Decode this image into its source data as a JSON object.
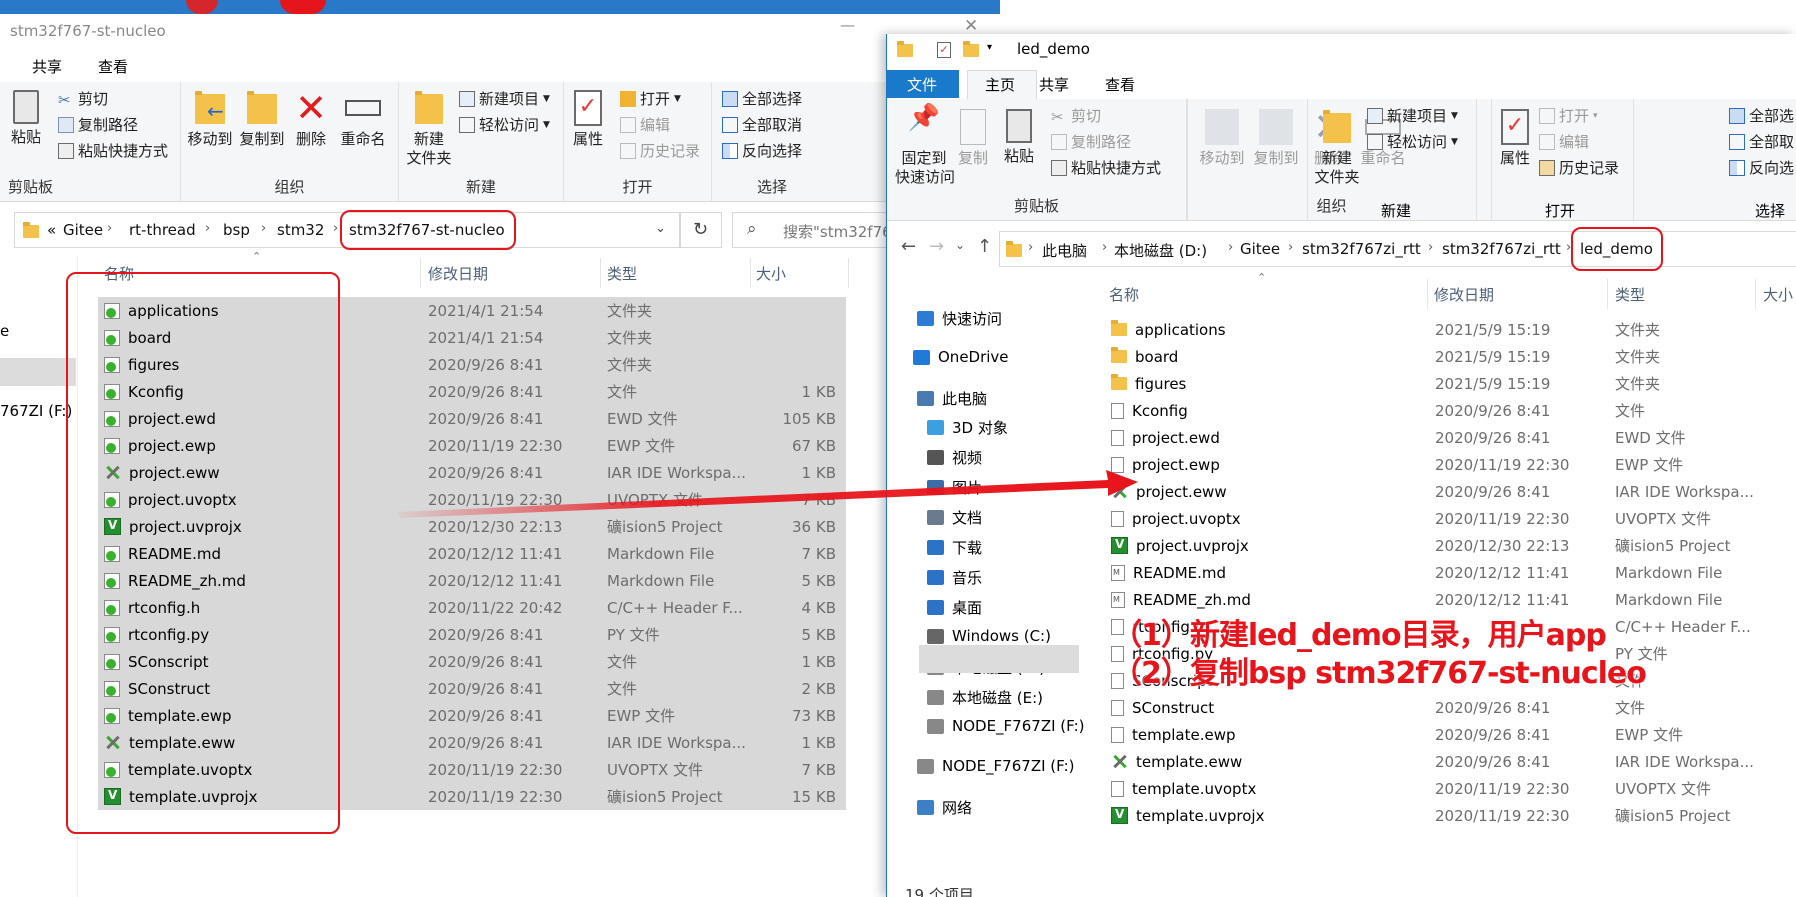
{
  "win1": {
    "title": "stm32f767-st-nucleo",
    "tabs": [
      "共享",
      "查看"
    ],
    "clipboard": {
      "paste": "粘贴",
      "cut": "剪切",
      "copy_path": "复制路径",
      "paste_shortcut": "粘贴快捷方式",
      "group": "剪贴板"
    },
    "organize": {
      "move_to": "移动到",
      "copy_to": "复制到",
      "delete": "删除",
      "rename": "重命名",
      "group": "组织"
    },
    "new": {
      "new_folder": "新建\n文件夹",
      "new_item": "新建项目",
      "easy_access": "轻松访问",
      "group": "新建"
    },
    "open": {
      "properties": "属性",
      "open": "打开",
      "edit": "编辑",
      "history": "历史记录",
      "group": "打开"
    },
    "select": {
      "select_all": "全部选择",
      "select_none": "全部取消",
      "invert": "反向选择",
      "group": "选择"
    },
    "address": {
      "crumbs": [
        "Gitee",
        "rt-thread",
        "bsp",
        "stm32",
        "stm32f767-st-nucleo"
      ],
      "prefix": "«"
    },
    "search_placeholder": "搜索\"stm32f76",
    "columns": {
      "name": "名称",
      "date": "修改日期",
      "type": "类型",
      "size": "大小"
    },
    "nav_fragments": [
      "e",
      "767ZI (F:)"
    ],
    "files": [
      {
        "name": "applications",
        "date": "2021/4/1 21:54",
        "type": "文件夹",
        "size": ""
      },
      {
        "name": "board",
        "date": "2021/4/1 21:54",
        "type": "文件夹",
        "size": ""
      },
      {
        "name": "figures",
        "date": "2020/9/26 8:41",
        "type": "文件夹",
        "size": ""
      },
      {
        "name": "Kconfig",
        "date": "2020/9/26 8:41",
        "type": "文件",
        "size": "1 KB"
      },
      {
        "name": "project.ewd",
        "date": "2020/9/26 8:41",
        "type": "EWD 文件",
        "size": "105 KB"
      },
      {
        "name": "project.ewp",
        "date": "2020/11/19 22:30",
        "type": "EWP 文件",
        "size": "67 KB"
      },
      {
        "name": "project.eww",
        "date": "2020/9/26 8:41",
        "type": "IAR IDE Workspa...",
        "size": "1 KB"
      },
      {
        "name": "project.uvoptx",
        "date": "2020/11/19 22:30",
        "type": "UVOPTX 文件",
        "size": "7 KB"
      },
      {
        "name": "project.uvprojx",
        "date": "2020/12/30 22:13",
        "type": "礦ision5 Project",
        "size": "36 KB"
      },
      {
        "name": "README.md",
        "date": "2020/12/12 11:41",
        "type": "Markdown File",
        "size": "7 KB"
      },
      {
        "name": "README_zh.md",
        "date": "2020/12/12 11:41",
        "type": "Markdown File",
        "size": "5 KB"
      },
      {
        "name": "rtconfig.h",
        "date": "2020/11/22 20:42",
        "type": "C/C++ Header F...",
        "size": "4 KB"
      },
      {
        "name": "rtconfig.py",
        "date": "2020/9/26 8:41",
        "type": "PY 文件",
        "size": "5 KB"
      },
      {
        "name": "SConscript",
        "date": "2020/9/26 8:41",
        "type": "文件",
        "size": "1 KB"
      },
      {
        "name": "SConstruct",
        "date": "2020/9/26 8:41",
        "type": "文件",
        "size": "2 KB"
      },
      {
        "name": "template.ewp",
        "date": "2020/9/26 8:41",
        "type": "EWP 文件",
        "size": "73 KB"
      },
      {
        "name": "template.eww",
        "date": "2020/9/26 8:41",
        "type": "IAR IDE Workspa...",
        "size": "1 KB"
      },
      {
        "name": "template.uvoptx",
        "date": "2020/11/19 22:30",
        "type": "UVOPTX 文件",
        "size": "7 KB"
      },
      {
        "name": "template.uvprojx",
        "date": "2020/11/19 22:30",
        "type": "礦ision5 Project",
        "size": "15 KB"
      }
    ]
  },
  "win2": {
    "title": "led_demo",
    "tabs": [
      "文件",
      "主页",
      "共享",
      "查看"
    ],
    "clipboard": {
      "pin": "固定到\n快速访问",
      "copy": "复制",
      "paste": "粘贴",
      "cut": "剪切",
      "copy_path": "复制路径",
      "paste_shortcut": "粘贴快捷方式",
      "group": "剪贴板"
    },
    "organize": {
      "move_to": "移动到",
      "copy_to": "复制到",
      "delete": "删除",
      "rename": "重命名",
      "group": "组织"
    },
    "new": {
      "new_folder": "新建\n文件夹",
      "new_item": "新建项目",
      "easy_access": "轻松访问",
      "group": "新建"
    },
    "open": {
      "properties": "属性",
      "open": "打开",
      "edit": "编辑",
      "history": "历史记录",
      "group": "打开"
    },
    "select": {
      "select_all": "全部选",
      "select_none": "全部取",
      "invert": "反向选",
      "group": "选择"
    },
    "address": {
      "crumbs": [
        "此电脑",
        "本地磁盘 (D:)",
        "Gitee",
        "stm32f767zi_rtt",
        "stm32f767zi_rtt",
        "led_demo"
      ]
    },
    "columns": {
      "name": "名称",
      "date": "修改日期",
      "type": "类型",
      "size": "大小"
    },
    "nav": [
      "快速访问",
      "OneDrive",
      "此电脑",
      "3D 对象",
      "视频",
      "图片",
      "文档",
      "下载",
      "音乐",
      "桌面",
      "Windows (C:)",
      "本地磁盘 (D:)",
      "本地磁盘 (E:)",
      "NODE_F767ZI (F:)",
      "NODE_F767ZI (F:)",
      "网络"
    ],
    "status": "19 个项目",
    "files": [
      {
        "name": "applications",
        "date": "2021/5/9 15:19",
        "type": "文件夹",
        "icon": "folder"
      },
      {
        "name": "board",
        "date": "2021/5/9 15:19",
        "type": "文件夹",
        "icon": "folder"
      },
      {
        "name": "figures",
        "date": "2021/5/9 15:19",
        "type": "文件夹",
        "icon": "folder"
      },
      {
        "name": "Kconfig",
        "date": "2020/9/26 8:41",
        "type": "文件",
        "icon": "file"
      },
      {
        "name": "project.ewd",
        "date": "2020/9/26 8:41",
        "type": "EWD 文件",
        "icon": "file"
      },
      {
        "name": "project.ewp",
        "date": "2020/11/19 22:30",
        "type": "EWP 文件",
        "icon": "file"
      },
      {
        "name": "project.eww",
        "date": "2020/9/26 8:41",
        "type": "IAR IDE Workspa...",
        "icon": "iar"
      },
      {
        "name": "project.uvoptx",
        "date": "2020/11/19 22:30",
        "type": "UVOPTX 文件",
        "icon": "file"
      },
      {
        "name": "project.uvprojx",
        "date": "2020/12/30 22:13",
        "type": "礦ision5 Project",
        "icon": "keil"
      },
      {
        "name": "README.md",
        "date": "2020/12/12 11:41",
        "type": "Markdown File",
        "icon": "md"
      },
      {
        "name": "README_zh.md",
        "date": "2020/12/12 11:41",
        "type": "Markdown File",
        "icon": "md"
      },
      {
        "name": "rtconfig.h",
        "date": "",
        "type": "C/C++ Header F...",
        "icon": "file"
      },
      {
        "name": "rtconfig.py",
        "date": "",
        "type": "PY 文件",
        "icon": "file"
      },
      {
        "name": "SConscript",
        "date": "",
        "type": "文件",
        "icon": "file"
      },
      {
        "name": "SConstruct",
        "date": "2020/9/26 8:41",
        "type": "文件",
        "icon": "file"
      },
      {
        "name": "template.ewp",
        "date": "2020/9/26 8:41",
        "type": "EWP 文件",
        "icon": "file"
      },
      {
        "name": "template.eww",
        "date": "2020/9/26 8:41",
        "type": "IAR IDE Workspa...",
        "icon": "iar"
      },
      {
        "name": "template.uvoptx",
        "date": "2020/11/19 22:30",
        "type": "UVOPTX 文件",
        "icon": "file"
      },
      {
        "name": "template.uvprojx",
        "date": "2020/11/19 22:30",
        "type": "礦ision5 Project",
        "icon": "keil"
      }
    ]
  },
  "annotation": {
    "line1": "（1）新建led_demo目录，用户app",
    "line2": "（2）复制bsp stm32f767-st-nucleo",
    "color": "#e8141b"
  }
}
